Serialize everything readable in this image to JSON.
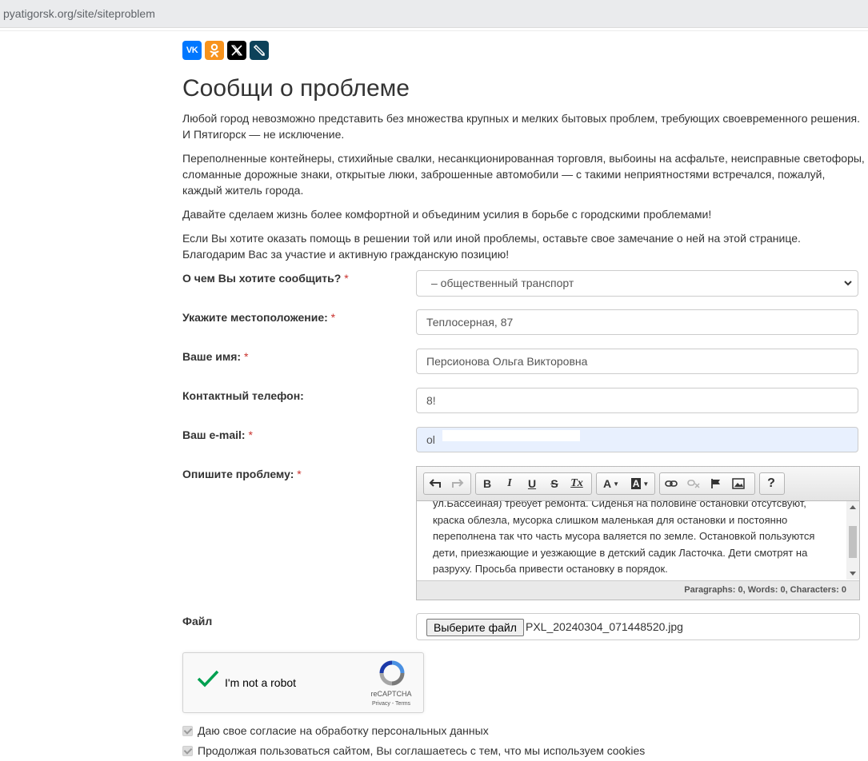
{
  "browser": {
    "url": "pyatigorsk.org/site/siteproblem"
  },
  "share": {
    "vk_text": "VK",
    "icons": [
      "vk-icon",
      "odnoklassniki-icon",
      "x-icon",
      "livejournal-icon"
    ],
    "colors": {
      "vk": "#0077ff",
      "ok": "#f7931e",
      "x": "#000000",
      "lj": "#0d425a"
    }
  },
  "page": {
    "title": "Сообщи о проблеме",
    "paragraphs": [
      "Любой город невозможно представить без множества крупных и мелких бытовых проблем, требующих своевременного решения. И Пятигорск — не исключение.",
      "Переполненные контейнеры, стихийные свалки, несанкционированная торговля, выбоины на асфальте, неисправные светофоры, сломанные дорожные знаки, открытые люки, заброшенные автомобили — с такими неприятностями встречался, пожалуй, каждый житель города.",
      "Давайте сделаем жизнь более комфортной и объединим усилия в борьбе с городскими проблемами!",
      "Если Вы хотите оказать помощь в решении той или иной проблемы, оставьте свое замечание о ней на этой странице. Благодарим Вас за участие и активную гражданскую позицию!"
    ]
  },
  "form": {
    "required_mark": "*",
    "topic": {
      "label": "О чем Вы хотите сообщить?",
      "value": "– общественный транспорт"
    },
    "location": {
      "label": "Укажите местоположение:",
      "value": "Теплосерная, 87"
    },
    "name": {
      "label": "Ваше имя:",
      "value": "Персионова Ольга Викторовна"
    },
    "phone": {
      "label": "Контактный телефон:",
      "value": "8!"
    },
    "email": {
      "label": "Ваш e-mail:",
      "value": "ol"
    },
    "problem": {
      "label": "Опишите проблему:",
      "text_lines": [
        "ул.Бассейная) требует ремонта. Сиденья на половине остановки отсутсвуют,",
        "краска облезла, мусорка слишком маленькая для остановки и постоянно",
        "переполнена так что часть мусора валяется по земле. Остановкой пользуются",
        "дети, приезжающие и уезжающие в детский садик Ласточка. Дети смотрят на",
        "разруху. Просьба привести остановку в порядок."
      ],
      "status": "Paragraphs: 0, Words: 0, Characters: 0",
      "toolbar": {
        "bold": "B",
        "italic": "I",
        "underline": "U",
        "strike": "S",
        "clear_format": "Tx",
        "text_color": "A",
        "bg_color": "A",
        "help": "?"
      }
    },
    "file": {
      "label": "Файл",
      "button": "Выберите файл",
      "filename": "PXL_20240304_071448520.jpg"
    },
    "captcha": {
      "text": "I'm not a robot",
      "brand": "reCAPTCHA",
      "terms": "Privacy - Terms"
    },
    "consents": [
      "Даю свое согласие на обработку персональных данных",
      "Продолжая пользоваться сайтом, Вы соглашаетесь с тем, что мы используем cookies"
    ]
  },
  "colors": {
    "required": "#c9302c",
    "autofill": "#e8f0fe",
    "captcha_check": "#00a050"
  }
}
